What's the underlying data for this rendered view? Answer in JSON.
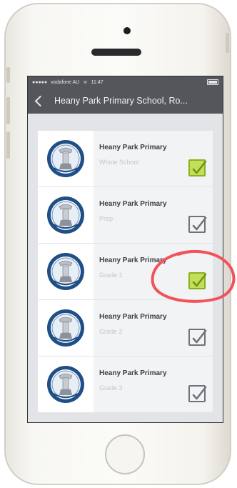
{
  "status_bar": {
    "carrier": "vodafone AU",
    "time": "11:47"
  },
  "nav": {
    "back_icon": "chevron-left-icon",
    "title": "Heany Park Primary School, Ro..."
  },
  "rows": [
    {
      "title": "Heany Park Primary",
      "subtitle": "Whole School",
      "checked": true
    },
    {
      "title": "Heany Park Primary",
      "subtitle": "Prep",
      "checked": false
    },
    {
      "title": "Heany Park Primary",
      "subtitle": "Grade 1",
      "checked": true
    },
    {
      "title": "Heany Park Primary",
      "subtitle": "Grade 2",
      "checked": false
    },
    {
      "title": "Heany Park Primary",
      "subtitle": "Grade 3",
      "checked": false
    }
  ],
  "colors": {
    "nav_bg": "#55565c",
    "check_on": "#c5de5a",
    "annotation": "#f0545a"
  }
}
